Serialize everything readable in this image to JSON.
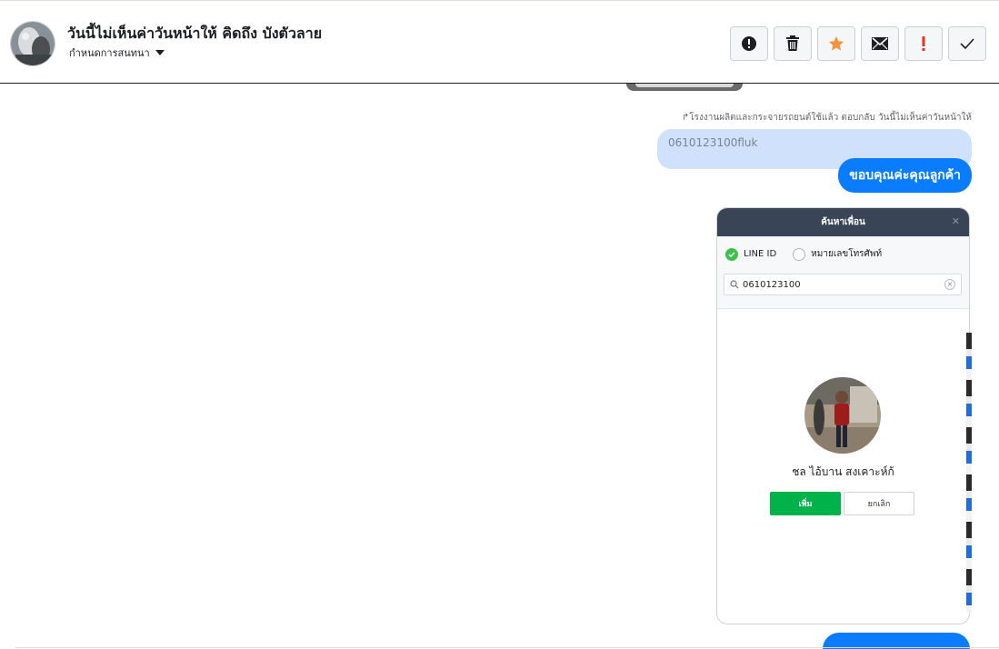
{
  "conversation": {
    "title": "วันนี้ไม่เห็นค่าวันหน้าให้ คิดถึง บังตัวลาย",
    "subtitle": "กำหนดการสนทนา"
  },
  "toolbar": {
    "buttons": [
      {
        "name": "report",
        "icon": "alert-circle-icon"
      },
      {
        "name": "delete",
        "icon": "trash-icon"
      },
      {
        "name": "star",
        "icon": "star-icon",
        "color": "#f7923a"
      },
      {
        "name": "mail",
        "icon": "envelope-icon"
      },
      {
        "name": "important",
        "icon": "exclamation-icon",
        "color": "#e4361b"
      },
      {
        "name": "done",
        "icon": "check-icon"
      }
    ]
  },
  "messages": {
    "reply_note": "↱โรงงานผลิตและกระจายรถยนต์ใช้แล้ว ตอบกลับ วันนี้ไม่เห็นค่าวันหน้าให้",
    "quoted_text": "0610123100fluk",
    "sent_text": "ขอบคุณค่ะคุณลูกค้า"
  },
  "line_dialog": {
    "title": "ค้นหาเพื่อน",
    "close": "✕",
    "option_line_id": "LINE ID",
    "option_phone": "หมายเลขโทรศัพท์",
    "search_value": "0610123100",
    "result_name": "ชล ไอ้บาน สงเคาะห์ก้",
    "add_label": "เพิ่ม",
    "cancel_label": "ยกเลิก"
  },
  "colors": {
    "accent": "#0a7cff",
    "quoted_bg": "#cfe1fb",
    "line_green": "#00b24a",
    "dialog_header": "#3a4457"
  }
}
